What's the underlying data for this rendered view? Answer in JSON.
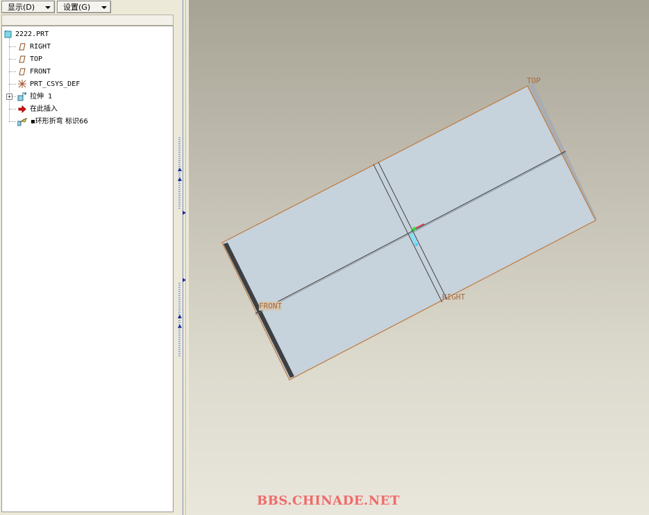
{
  "toolbar": {
    "display_label": "显示(D)",
    "settings_label": "设置(G)"
  },
  "tree": {
    "root": {
      "label": "2222.PRT",
      "icon": "part-icon"
    },
    "items": [
      {
        "label": "RIGHT",
        "icon": "datum-plane-icon"
      },
      {
        "label": "TOP",
        "icon": "datum-plane-icon"
      },
      {
        "label": "FRONT",
        "icon": "datum-plane-icon"
      },
      {
        "label": "PRT_CSYS_DEF",
        "icon": "coordinate-system-icon"
      },
      {
        "label": "拉伸 1",
        "icon": "extrude-feature-icon",
        "expandable": true
      },
      {
        "label": "在此插入",
        "icon": "insert-here-arrow-icon"
      },
      {
        "label": "▪环形折弯 标识66",
        "icon": "toroidal-bend-icon"
      }
    ]
  },
  "viewport": {
    "datum_labels": {
      "top": "TOP",
      "front": "FRONT",
      "right": "RIGHT"
    },
    "colors": {
      "part_face": "#c6d2dc",
      "part_edge": "#c07a3c",
      "datum_label": "#a8693a",
      "background_top": "#a7a394",
      "background_bottom": "#e9e6dc"
    }
  },
  "watermark": "BBS.CHINADE.NET"
}
